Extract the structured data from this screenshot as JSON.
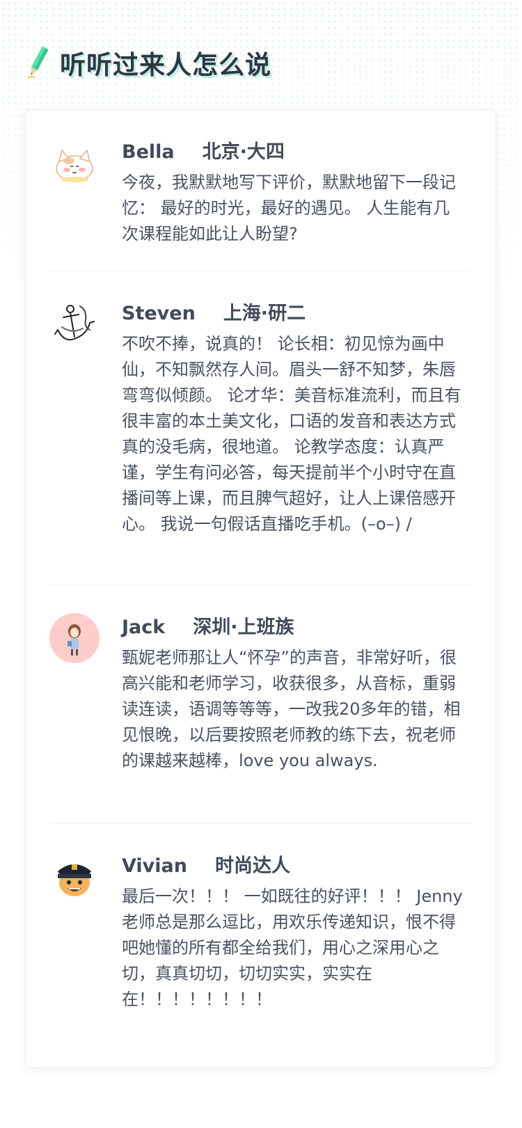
{
  "header": {
    "title": "听听过来人怎么说",
    "icon": "pencil-icon",
    "accent_color": "#35c98f"
  },
  "reviews": [
    {
      "name": "Bella",
      "location": "北京·大四",
      "avatar": "cat-avatar",
      "text": "今夜，我默默地写下评价，默默地留下一段记忆： 最好的时光，最好的遇见。 人生能有几次课程能如此让人盼望?"
    },
    {
      "name": "Steven",
      "location": "上海·研二",
      "avatar": "anchor-avatar",
      "text": "不吹不捧，说真的！ 论长相：初见惊为画中仙，不知飘然存人间。眉头一舒不知梦，朱唇弯弯似倾颜。 论才华：美音标准流利，而且有很丰富的本土美文化，口语的发音和表达方式真的没毛病，很地道。 论教学态度：认真严谨，学生有问必答，每天提前半个小时守在直播间等上课，而且脾气超好，让人上课倍感开心。 我说一句假话直播吃手机。(–o–) /"
    },
    {
      "name": "Jack",
      "location": "深圳·上班族",
      "avatar": "girl-avatar",
      "text": "甄妮老师那让人“怀孕”的声音，非常好听，很高兴能和老师学习，收获很多，从音标，重弱读连读，语调等等等，一改我20多年的错，相见恨晚，以后要按照老师教的练下去，祝老师的课越来越棒，love you always."
    },
    {
      "name": "Vivian",
      "location": "时尚达人",
      "avatar": "police-avatar",
      "text": "最后一次！！！ 一如既往的好评！！！ Jenny 老师总是那么逗比，用欢乐传递知识，恨不得吧她懂的所有都全给我们，用心之深用心之切，真真切切，切切实实，实实在在！！！！！！！！"
    }
  ]
}
